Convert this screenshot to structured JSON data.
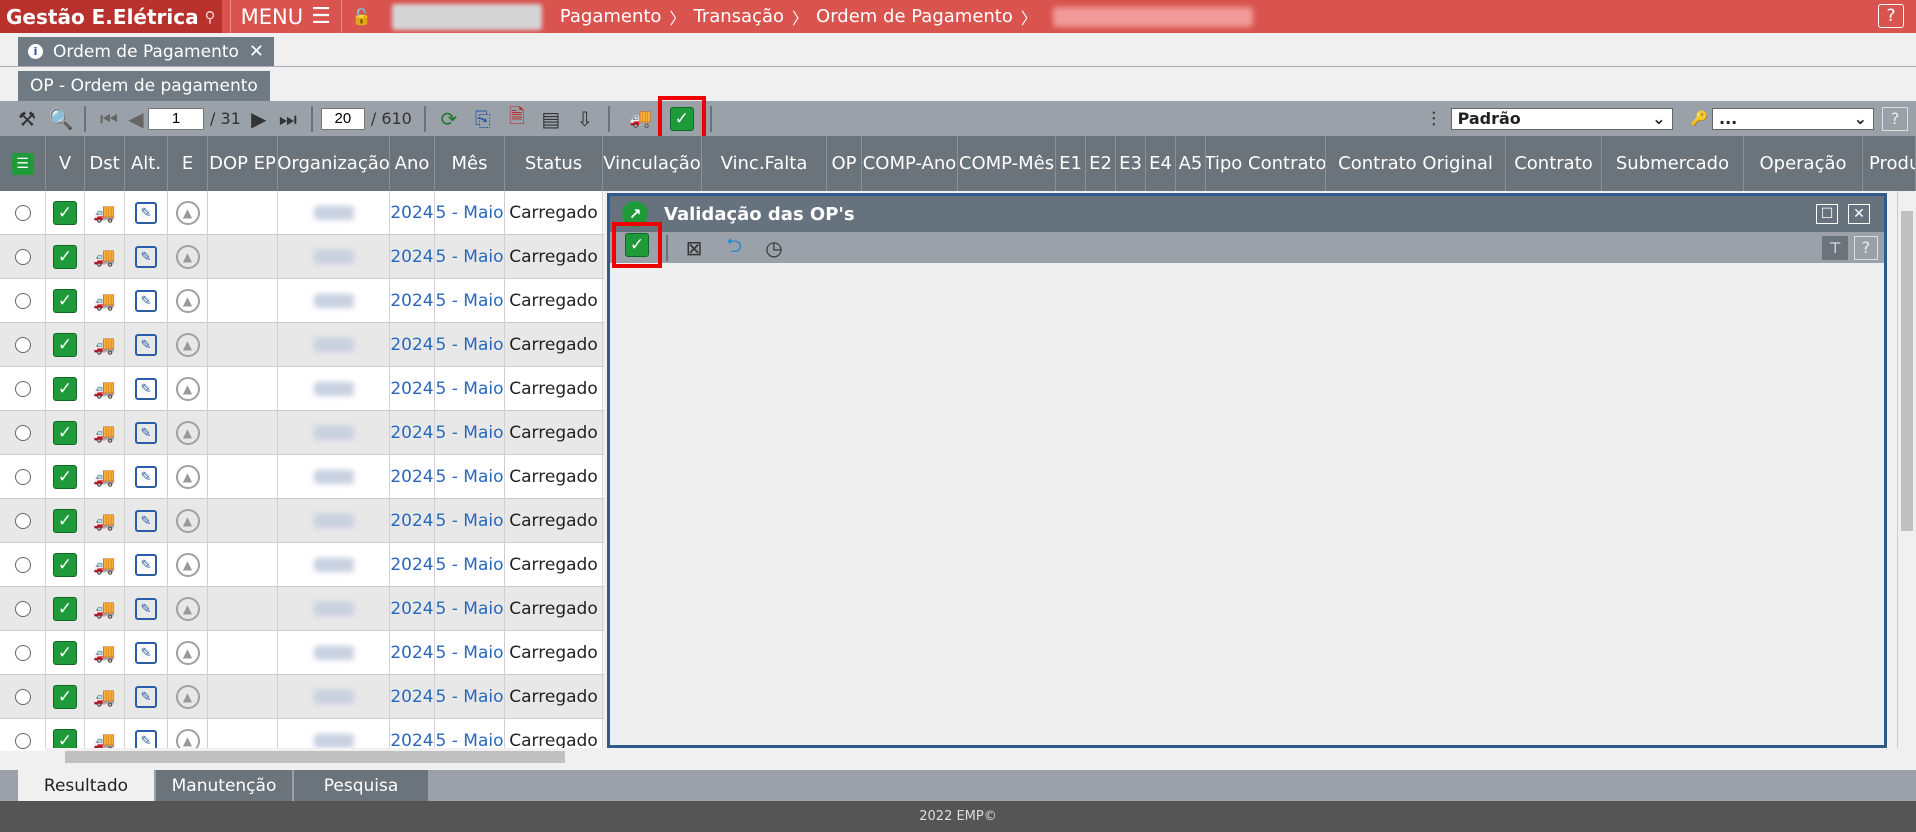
{
  "app": {
    "brand": "Gestão E.Elétrica",
    "menu_label": "MENU",
    "help": "?"
  },
  "breadcrumb": [
    "Pagamento",
    "Transação",
    "Ordem de Pagamento"
  ],
  "tab": {
    "label": "Ordem de Pagamento"
  },
  "subtab": {
    "label": "OP - Ordem de pagamento"
  },
  "toolbar": {
    "page": "1",
    "page_total": "/ 31",
    "page_size": "20",
    "record_total": "/ 610",
    "view_select": "Padrão",
    "filter_select": "...",
    "help": "?"
  },
  "columns": [
    "V",
    "Dst",
    "Alt.",
    "E",
    "DOP EP",
    "Organização",
    "Ano",
    "Mês",
    "Status",
    "Vinculação",
    "Vinc.Falta",
    "OP",
    "COMP-Ano",
    "COMP-Mês",
    "E1",
    "E2",
    "E3",
    "E4",
    "A5",
    "Tipo Contrato",
    "Contrato Original",
    "Contrato",
    "Submercado",
    "Operação",
    "Produ"
  ],
  "rows": [
    {
      "ano": "2024",
      "mes": "5 - Maio",
      "status": "Carregado"
    },
    {
      "ano": "2024",
      "mes": "5 - Maio",
      "status": "Carregado"
    },
    {
      "ano": "2024",
      "mes": "5 - Maio",
      "status": "Carregado"
    },
    {
      "ano": "2024",
      "mes": "5 - Maio",
      "status": "Carregado"
    },
    {
      "ano": "2024",
      "mes": "5 - Maio",
      "status": "Carregado"
    },
    {
      "ano": "2024",
      "mes": "5 - Maio",
      "status": "Carregado"
    },
    {
      "ano": "2024",
      "mes": "5 - Maio",
      "status": "Carregado"
    },
    {
      "ano": "2024",
      "mes": "5 - Maio",
      "status": "Carregado"
    },
    {
      "ano": "2024",
      "mes": "5 - Maio",
      "status": "Carregado"
    },
    {
      "ano": "2024",
      "mes": "5 - Maio",
      "status": "Carregado"
    },
    {
      "ano": "2024",
      "mes": "5 - Maio",
      "status": "Carregado"
    },
    {
      "ano": "2024",
      "mes": "5 - Maio",
      "status": "Carregado"
    },
    {
      "ano": "2024",
      "mes": "5 - Maio",
      "status": "Carregado"
    }
  ],
  "dialog": {
    "title": "Validação das OP's"
  },
  "bottom_tabs": [
    "Resultado",
    "Manutenção",
    "Pesquisa"
  ],
  "footer": "2022 EMP©",
  "colors": {
    "topbar": "#d9534f",
    "accent_green": "#1f9a3a",
    "header_gray": "#6b737b",
    "highlight_red": "#e00000",
    "dialog_border": "#2f5a8a"
  }
}
